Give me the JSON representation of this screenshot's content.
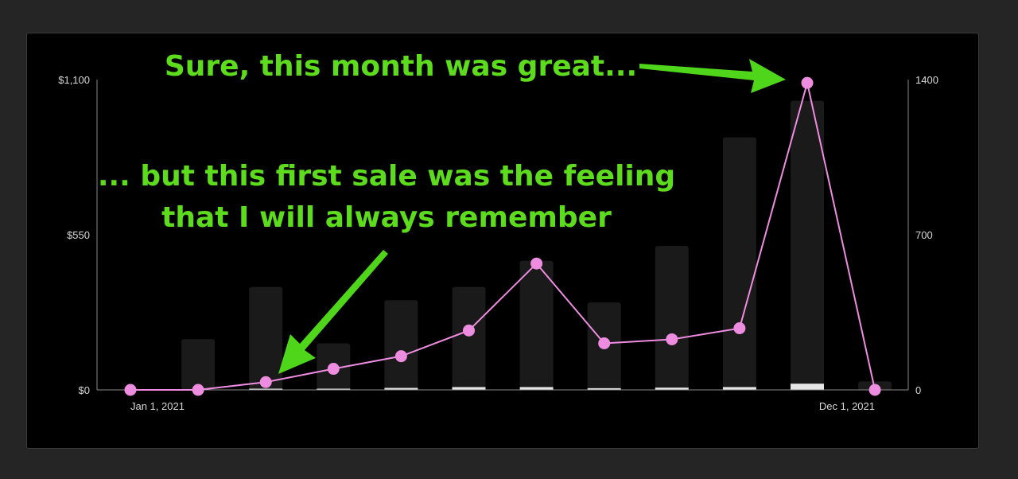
{
  "colors": {
    "page_background": "#252525",
    "card_background": "#000000",
    "bar_fill": "#1a1a1a",
    "bar_accent": "#e6e6e6",
    "line": "#ee8ce0",
    "point": "#ee8ce0",
    "annotation_text": "#5ddb1d",
    "annotation_arrow": "#4fd61a",
    "axis_text": "#d8d8d8"
  },
  "chart_data": {
    "type": "bar",
    "title": "",
    "x": [
      "2021-01-01",
      "2021-02-01",
      "2021-03-01",
      "2021-04-01",
      "2021-05-01",
      "2021-06-01",
      "2021-07-01",
      "2021-08-01",
      "2021-09-01",
      "2021-10-01",
      "2021-11-01",
      "2021-12-01"
    ],
    "x_tick_labels": [
      "Jan 1, 2021",
      "Dec 1, 2021"
    ],
    "series": [
      {
        "axis": "left",
        "kind": "bar",
        "values": [
          0,
          180,
          365,
          165,
          318,
          365,
          458,
          310,
          510,
          895,
          1025,
          30
        ]
      },
      {
        "axis": "left",
        "kind": "bar-overlay",
        "values": [
          0,
          0,
          2,
          3,
          7,
          10,
          10,
          6,
          8,
          10,
          22,
          0
        ]
      },
      {
        "axis": "right",
        "kind": "line",
        "values": [
          0,
          0,
          35,
          95,
          152,
          268,
          570,
          210,
          228,
          278,
          1385,
          0
        ]
      }
    ],
    "y_left": {
      "ylim": [
        0,
        1100
      ],
      "ticks": [
        "$0",
        "$550",
        "$1,100"
      ]
    },
    "y_right": {
      "ylim": [
        0,
        1400
      ],
      "ticks": [
        "0",
        "700",
        "1400"
      ]
    },
    "grid": false,
    "legend": "none",
    "annotations": [
      {
        "text": "Sure, this month was great...",
        "points_to": "2021-11-01"
      },
      {
        "lines": [
          "... but this first sale was the feeling",
          "that I will always remember"
        ],
        "points_to": "2021-03-01"
      }
    ]
  }
}
